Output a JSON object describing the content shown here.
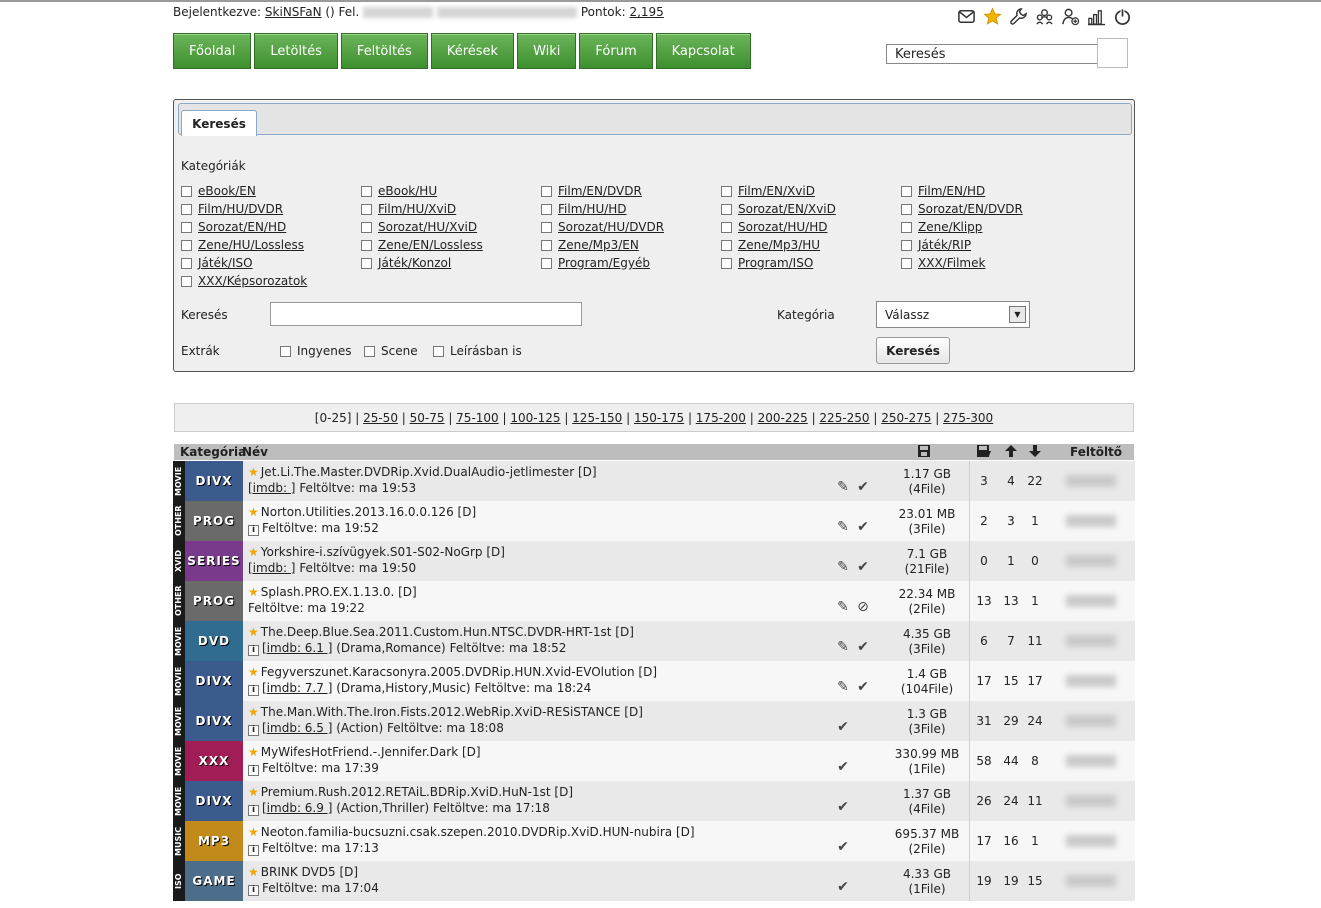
{
  "user": {
    "logged_label": "Bejelentkezve:",
    "username": "SkiNSFaN",
    "suffix": "() Fel.",
    "points_label": "Pontok:",
    "points": "2,195"
  },
  "top_icons": [
    "mail-icon",
    "star-icon",
    "wrench-icon",
    "users-icon",
    "user-add-icon",
    "stats-icon",
    "power-icon"
  ],
  "nav": [
    "Főoldal",
    "Letöltés",
    "Feltöltés",
    "Kérések",
    "Wiki",
    "Fórum",
    "Kapcsolat"
  ],
  "top_search": {
    "value": "Keresés"
  },
  "panel": {
    "tab": "Keresés",
    "categories_label": "Kategóriák",
    "categories": [
      "eBook/EN",
      "eBook/HU",
      "Film/EN/DVDR",
      "Film/EN/XviD",
      "Film/EN/HD",
      "Film/HU/DVDR",
      "Film/HU/XviD",
      "Film/HU/HD",
      "Sorozat/EN/XviD",
      "Sorozat/EN/DVDR",
      "Sorozat/EN/HD",
      "Sorozat/HU/XviD",
      "Sorozat/HU/DVDR",
      "Sorozat/HU/HD",
      "Zene/Klipp",
      "Zene/HU/Lossless",
      "Zene/EN/Lossless",
      "Zene/Mp3/EN",
      "Zene/Mp3/HU",
      "Játék/RIP",
      "Játék/ISO",
      "Játék/Konzol",
      "Program/Egyéb",
      "Program/ISO",
      "XXX/Filmek",
      "XXX/Képsorozatok"
    ],
    "search_label": "Keresés",
    "category_label": "Kategória",
    "category_select": "Válassz",
    "extras_label": "Extrák",
    "extras": [
      "Ingyenes",
      "Scene",
      "Leírásban is"
    ],
    "search_button": "Keresés"
  },
  "pager": {
    "current": "[0-25]",
    "links": [
      "25-50",
      "50-75",
      "75-100",
      "100-125",
      "125-150",
      "150-175",
      "175-200",
      "200-225",
      "225-250",
      "250-275",
      "275-300"
    ]
  },
  "table": {
    "headers": {
      "category": "Kategória",
      "name": "Név",
      "uploader": "Feltöltő"
    },
    "rows": [
      {
        "side": "MOVIE",
        "label": "DIVX",
        "color": "#3b5b8c",
        "name": "Jet.Li.The.Master.DVDRip.Xvid.DualAudio-jetlimester [D]",
        "imdb": "[imdb: ]",
        "meta": "",
        "uploaded": "Feltöltve: ma 19:53",
        "info": false,
        "size": "1.17 GB",
        "files": "(4File)",
        "a": "3",
        "b": "4",
        "c": "22",
        "acts": [
          "edit",
          "check"
        ]
      },
      {
        "side": "OTHER",
        "label": "PROG",
        "color": "#6a6a6a",
        "name": "Norton.Utilities.2013.16.0.0.126 [D]",
        "imdb": "",
        "meta": "",
        "uploaded": "Feltöltve: ma 19:52",
        "info": true,
        "size": "23.01 MB",
        "files": "(3File)",
        "a": "2",
        "b": "3",
        "c": "1",
        "acts": [
          "edit",
          "check"
        ]
      },
      {
        "side": "XVID",
        "label": "SERIES",
        "color": "#7a3a8c",
        "name": "Yorkshire-i.szívügyek.S01-S02-NoGrp [D]",
        "imdb": "[imdb: ]",
        "meta": "",
        "uploaded": "Feltöltve: ma 19:50",
        "info": false,
        "size": "7.1 GB",
        "files": "(21File)",
        "a": "0",
        "b": "1",
        "c": "0",
        "acts": [
          "edit",
          "check"
        ]
      },
      {
        "side": "OTHER",
        "label": "PROG",
        "color": "#6a6a6a",
        "name": "Splash.PRO.EX.1.13.0. [D]",
        "imdb": "",
        "meta": "",
        "uploaded": "Feltöltve: ma 19:22",
        "info": false,
        "size": "22.34 MB",
        "files": "(2File)",
        "a": "13",
        "b": "13",
        "c": "1",
        "acts": [
          "edit",
          "warn"
        ]
      },
      {
        "side": "MOVIE",
        "label": "DVD",
        "color": "#2f6c8f",
        "name": "The.Deep.Blue.Sea.2011.Custom.Hun.NTSC.DVDR-HRT-1st [D]",
        "imdb": "[imdb: 6.1 ]",
        "meta": "(Drama,Romance)",
        "uploaded": "Feltöltve: ma 18:52",
        "info": true,
        "size": "4.35 GB",
        "files": "(3File)",
        "a": "6",
        "b": "7",
        "c": "11",
        "acts": [
          "edit",
          "check"
        ]
      },
      {
        "side": "MOVIE",
        "label": "DIVX",
        "color": "#3b5b8c",
        "name": "Fegyverszunet.Karacsonyra.2005.DVDRip.HUN.Xvid-EVOlution [D]",
        "imdb": "[imdb: 7.7 ]",
        "meta": "(Drama,History,Music)",
        "uploaded": "Feltöltve: ma 18:24",
        "info": true,
        "size": "1.4 GB",
        "files": "(104File)",
        "a": "17",
        "b": "15",
        "c": "17",
        "acts": [
          "edit",
          "check"
        ]
      },
      {
        "side": "MOVIE",
        "label": "DIVX",
        "color": "#3b5b8c",
        "name": "The.Man.With.The.Iron.Fists.2012.WebRip.XviD-RESiSTANCE [D]",
        "imdb": "[imdb: 6.5 ]",
        "meta": "(Action)",
        "uploaded": "Feltöltve: ma 18:08",
        "info": true,
        "size": "1.3 GB",
        "files": "(3File)",
        "a": "31",
        "b": "29",
        "c": "24",
        "acts": [
          "check"
        ]
      },
      {
        "side": "MOVIE",
        "label": "XXX",
        "color": "#a11d55",
        "name": "MyWifesHotFriend.-.Jennifer.Dark [D]",
        "imdb": "",
        "meta": "",
        "uploaded": "Feltöltve: ma 17:39",
        "info": true,
        "size": "330.99 MB",
        "files": "(1File)",
        "a": "58",
        "b": "44",
        "c": "8",
        "acts": [
          "check"
        ]
      },
      {
        "side": "MOVIE",
        "label": "DIVX",
        "color": "#3b5b8c",
        "name": "Premium.Rush.2012.RETAiL.BDRip.XviD.HuN-1st [D]",
        "imdb": "[imdb: 6.9 ]",
        "meta": "(Action,Thriller)",
        "uploaded": "Feltöltve: ma 17:18",
        "info": true,
        "size": "1.37 GB",
        "files": "(4File)",
        "a": "26",
        "b": "24",
        "c": "11",
        "acts": [
          "check"
        ]
      },
      {
        "side": "MUSIC",
        "label": "MP3",
        "color": "#c28a1a",
        "name": "Neoton.familia-bucsuzni.csak.szepen.2010.DVDRip.XviD.HUN-nubira [D]",
        "imdb": "",
        "meta": "",
        "uploaded": "Feltöltve: ma 17:13",
        "info": true,
        "size": "695.37 MB",
        "files": "(2File)",
        "a": "17",
        "b": "16",
        "c": "1",
        "acts": [
          "check"
        ]
      },
      {
        "side": "ISO",
        "label": "GAME",
        "color": "#4d6e8a",
        "name": "BRINK DVD5 [D]",
        "imdb": "",
        "meta": "",
        "uploaded": "Feltöltve: ma 17:04",
        "info": true,
        "size": "4.33 GB",
        "files": "(1File)",
        "a": "19",
        "b": "19",
        "c": "15",
        "acts": [
          "check"
        ]
      }
    ]
  }
}
